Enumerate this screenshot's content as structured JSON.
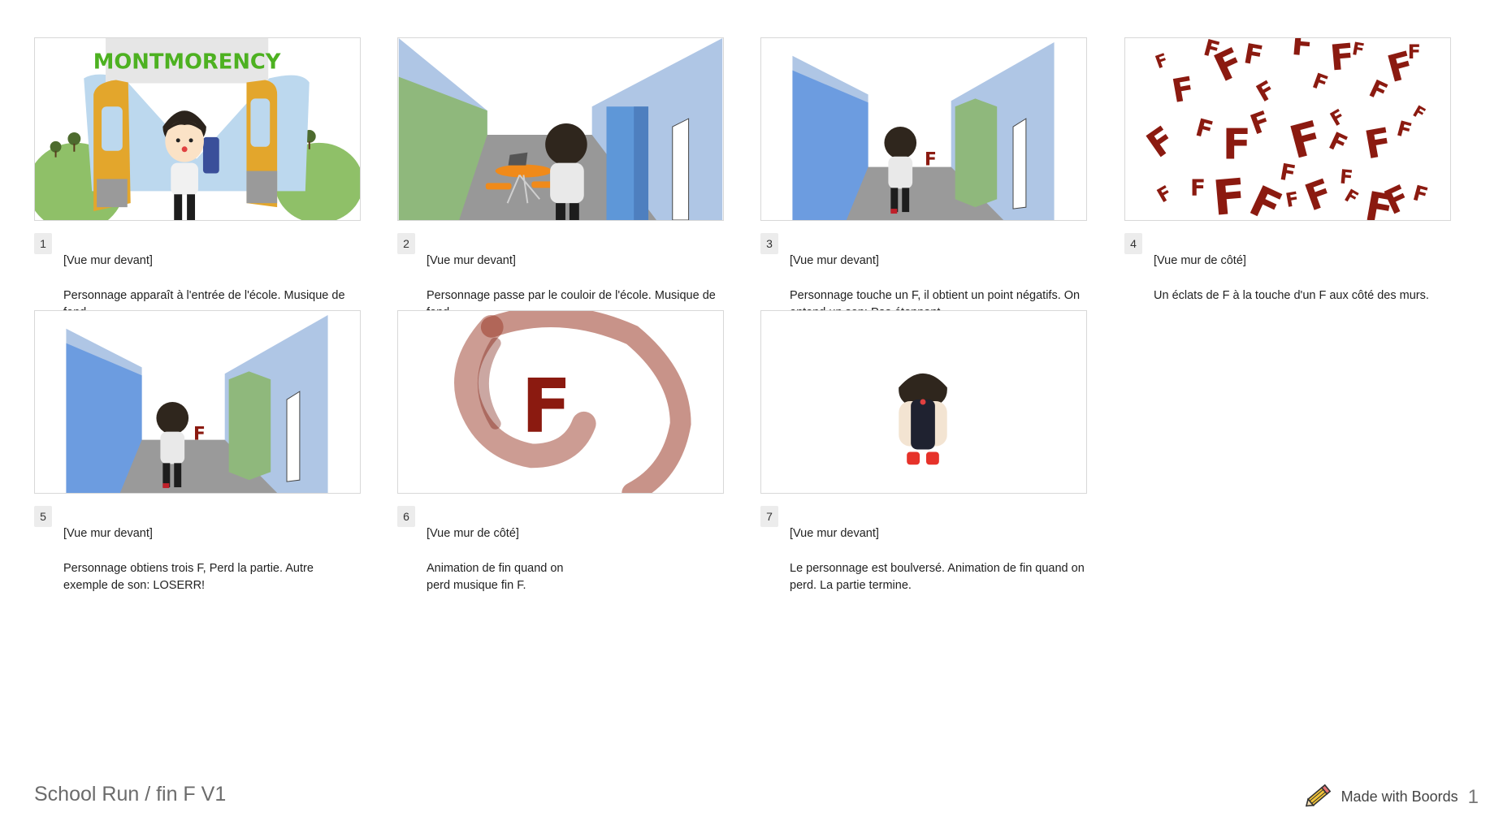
{
  "storyboard": {
    "title": "School Run / fin F V1",
    "branding": "Made with Boords",
    "page_number": "1",
    "frames": [
      {
        "number": "1",
        "view": "[Vue mur devant]",
        "description": "Personnage apparaît à l'entrée de l'école. Musique de fond.",
        "sign_text": "MONTMORENCY"
      },
      {
        "number": "2",
        "view": "[Vue mur devant]",
        "description": "Personnage passe par le couloir de l'école. Musique de fond."
      },
      {
        "number": "3",
        "view": "[Vue mur devant]",
        "description": "Personnage touche un F, il obtient un point négatifs. On entend un son: Pas étonnant.",
        "letter": "F"
      },
      {
        "number": "4",
        "view": "[Vue mur de côté]",
        "description": "Un éclats de F à la touche d'un F aux côté des murs.",
        "letter": "F"
      },
      {
        "number": "5",
        "view": "[Vue mur devant]",
        "description": "Personnage obtiens trois F, Perd la partie. Autre exemple de son: LOSERR!",
        "letter": "F"
      },
      {
        "number": "6",
        "view": "[Vue mur de côté]",
        "description": "Animation de fin quand on\nperd musique fin F.",
        "letter": "F"
      },
      {
        "number": "7",
        "view": "[Vue mur devant]",
        "description": "Le personnage est boulversé. Animation de fin quand on perd. La partie termine."
      }
    ]
  },
  "icons": {
    "branding_icon": "pencil-icon"
  }
}
